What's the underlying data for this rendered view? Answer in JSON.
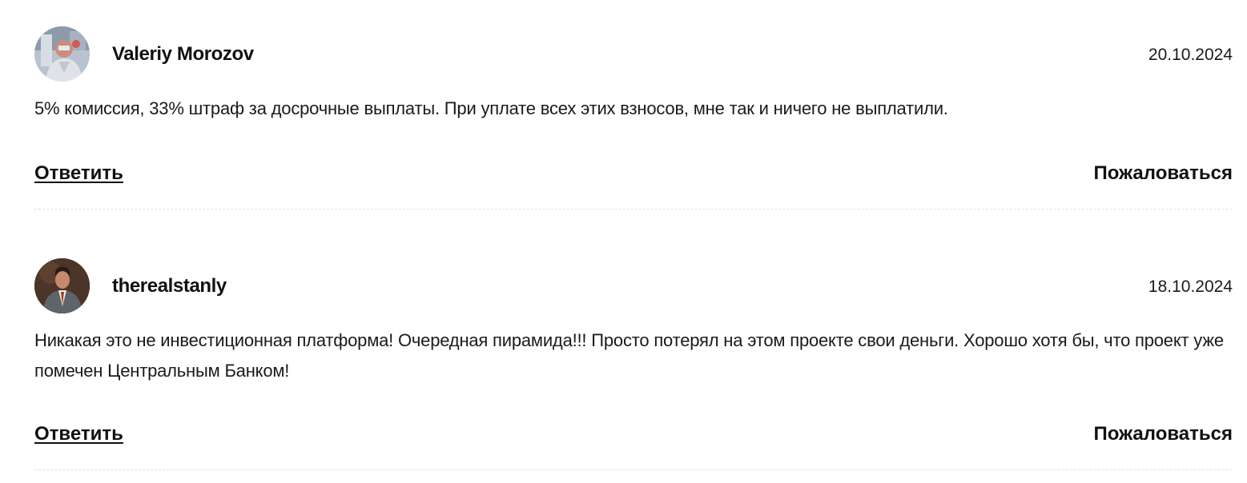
{
  "comments": [
    {
      "author": "Valeriy Morozov",
      "date": "20.10.2024",
      "text": "5% комиссия, 33% штраф за досрочные выплаты. При уплате всех этих взносов, мне так и ничего не выплатили.",
      "reply_label": "Ответить",
      "report_label": "Пожаловаться",
      "avatar_icon": "user-photo-avatar"
    },
    {
      "author": "therealstanly",
      "date": "18.10.2024",
      "text": "Никакая это не инвестиционная платформа! Очередная пирамида!!! Просто потерял на этом проекте свои деньги. Хорошо хотя бы, что проект уже помечен Центральным Банком!",
      "reply_label": "Ответить",
      "report_label": "Пожаловаться",
      "avatar_icon": "user-photo-avatar"
    }
  ],
  "colors": {
    "text": "#111111",
    "divider": "#dcdcdc",
    "background": "#ffffff"
  }
}
